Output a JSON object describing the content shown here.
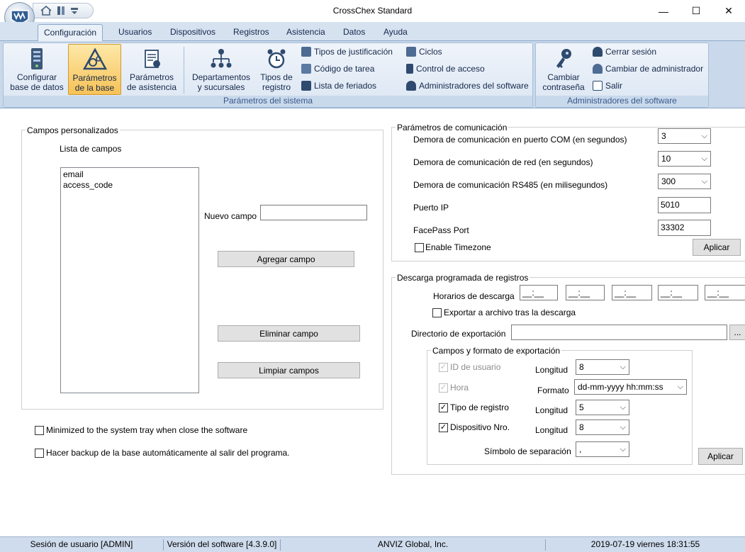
{
  "window": {
    "title": "CrossChex Standard",
    "minimize_glyph": "—",
    "maximize_glyph": "☐",
    "close_glyph": "✕"
  },
  "menu_tabs": [
    {
      "label": "Configuración",
      "active": true
    },
    {
      "label": "Usuarios"
    },
    {
      "label": "Dispositivos"
    },
    {
      "label": "Registros"
    },
    {
      "label": "Asistencia"
    },
    {
      "label": "Datos"
    },
    {
      "label": "Ayuda"
    }
  ],
  "ribbon": {
    "groups": {
      "system": "Parámetros del sistema",
      "admins": "Administradores del software"
    },
    "big_buttons": {
      "config_db": [
        "Configurar",
        "base de datos"
      ],
      "base_params": [
        "Parámetros",
        "de la base"
      ],
      "attendance_params": [
        "Parámetros",
        "de asistencia"
      ],
      "departments": [
        "Departamentos",
        "y sucursales"
      ],
      "record_types": [
        "Tipos de",
        "registro"
      ],
      "change_password": [
        "Cambiar",
        "contraseña"
      ]
    },
    "small_buttons": {
      "justification_types": "Tipos de justificación",
      "task_code": "Código de tarea",
      "holidays": "Lista de feriados",
      "cycles": "Ciclos",
      "access_control": "Control de acceso",
      "software_admins": "Administradores del software",
      "logout": "Cerrar sesión",
      "change_admin": "Cambiar de administrador",
      "exit": "Salir"
    }
  },
  "custom_fields": {
    "legend": "Campos personalizados",
    "list_label": "Lista de campos",
    "items": [
      "email",
      "access_code"
    ],
    "new_field_label": "Nuevo campo",
    "new_field_value": "",
    "add_button": "Agregar campo",
    "delete_button": "Eliminar campo",
    "clear_button": "Limpiar campos"
  },
  "options": {
    "minimize_tray": "Minimized to the system tray when close the software",
    "auto_backup": "Hacer backup de la base automáticamente al salir del programa."
  },
  "communication": {
    "legend": "Parámetros de comunicación",
    "com_delay_label": "Demora de comunicación en puerto COM (en segundos)",
    "com_delay_value": "3",
    "net_delay_label": "Demora de comunicación de red (en segundos)",
    "net_delay_value": "10",
    "rs485_delay_label": "Demora de comunicación RS485 (en milisegundos)",
    "rs485_delay_value": "300",
    "ip_port_label": "Puerto IP",
    "ip_port_value": "5010",
    "facepass_label": "FacePass Port",
    "facepass_value": "33302",
    "timezone_label": "Enable Timezone",
    "apply_button": "Aplicar"
  },
  "scheduled_download": {
    "legend": "Descarga programada de registros",
    "times_label": "Horarios de descarga",
    "time_slots": [
      "__:__",
      "__:__",
      "__:__",
      "__:__",
      "__:__"
    ],
    "export_after_label": "Exportar a archivo tras la descarga",
    "export_dir_label": "Directorio de exportación",
    "export_dir_value": "",
    "browse_button": "...",
    "fields_legend": "Campos y formato de exportación",
    "user_id_label": "ID de usuario",
    "hora_label": "Hora",
    "record_type_label": "Tipo de registro",
    "device_no_label": "Dispositivo Nro.",
    "length_label": "Longitud",
    "format_label": "Formato",
    "user_id_length": "8",
    "format_value": "dd-mm-yyyy hh:mm:ss",
    "record_type_length": "5",
    "device_no_length": "8",
    "separator_label": "Símbolo de separación",
    "separator_value": ",",
    "apply_button": "Aplicar"
  },
  "status_bar": {
    "session": "Sesión de usuario  [ADMIN]",
    "version": "Versión del software  [4.3.9.0]",
    "company": "ANVIZ Global, Inc.",
    "datetime": "2019-07-19 viernes 18:31:55"
  },
  "colors": {
    "ribbon_bg": "#c9d8ea",
    "active_button": "#f7c257",
    "status_bar": "#cfdced"
  }
}
